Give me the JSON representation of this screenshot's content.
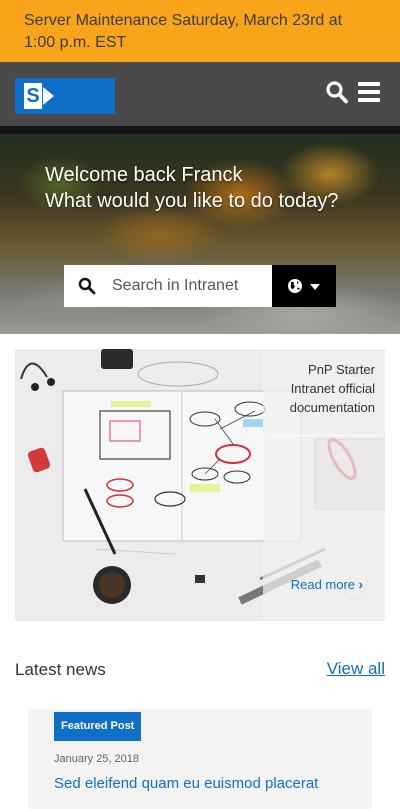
{
  "banner": {
    "text": "Server Maintenance Saturday, March 23rd at 1:00 p.m. EST",
    "color": "#f8a51b"
  },
  "header": {
    "logo_icon": "sharepoint-logo",
    "search_icon": "search-icon",
    "menu_icon": "hamburger-menu-icon",
    "background": "#4a4a4a"
  },
  "hero": {
    "greeting_line1": "Welcome back Franck",
    "greeting_line2": "What would you like to do today?",
    "search": {
      "placeholder": "Search in Intranet",
      "value": ""
    },
    "scope_icon": "globe-icon"
  },
  "feature_card": {
    "title": "PnP Starter Intranet official documentation",
    "link_label": "Read more",
    "link_icon": "chevron-right-icon"
  },
  "news": {
    "heading": "Latest news",
    "view_all_label": "View all",
    "items": [
      {
        "badge": "Featured Post",
        "date": "January 25, 2018",
        "title": "Sed eleifend quam eu euismod placerat"
      }
    ]
  },
  "colors": {
    "accent": "#0f6fc6",
    "banner": "#f8a51b"
  }
}
